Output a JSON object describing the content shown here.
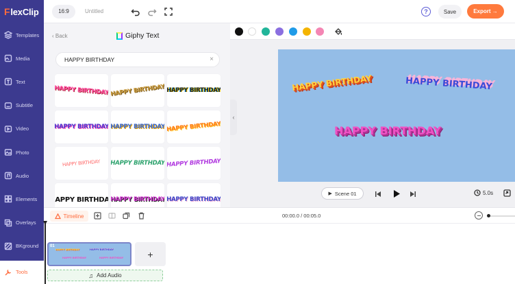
{
  "app": {
    "brand_f": "F",
    "brand_rest": "lexClip"
  },
  "topbar": {
    "ratio": "16:9",
    "title": "Untitled",
    "save": "Save",
    "export": "Export →",
    "help": "?"
  },
  "sidebar": {
    "items": [
      {
        "label": "Templates",
        "icon": "templates-icon"
      },
      {
        "label": "Media",
        "icon": "media-icon"
      },
      {
        "label": "Text",
        "icon": "text-icon"
      },
      {
        "label": "Subtitle",
        "icon": "subtitle-icon"
      },
      {
        "label": "Video",
        "icon": "video-icon"
      },
      {
        "label": "Photo",
        "icon": "photo-icon"
      },
      {
        "label": "Audio",
        "icon": "audio-icon"
      },
      {
        "label": "Elements",
        "icon": "elements-icon"
      },
      {
        "label": "Overlays",
        "icon": "overlays-icon"
      },
      {
        "label": "BKground",
        "icon": "background-icon"
      },
      {
        "label": "Tools",
        "icon": "tools-icon",
        "active": true
      }
    ]
  },
  "panel": {
    "back": "‹ Back",
    "title": "Giphy Text",
    "search_value": "HAPPY BIRTHDAY",
    "search_clear": "×",
    "thumbs": [
      {
        "text": "HAPPY BIRTHDAY",
        "color": "#ff4fa3"
      },
      {
        "text": "HAPPY BIRTHDAY",
        "color": "#c89a3c"
      },
      {
        "text": "HAPPY BIRTHDAY",
        "color": "#222222"
      },
      {
        "text": "HAPPY BIRTHDAY",
        "color": "#4b3bd1"
      },
      {
        "text": "HAPPY BIRTHDAY",
        "color": "#3a6bd8"
      },
      {
        "text": "HAPPY BIRTHDAY",
        "color": "#ff7a1a"
      },
      {
        "text": "HAPPY BIRTHDAY",
        "color": "#ff6e6e"
      },
      {
        "text": "HAPPY BIRTHDAY",
        "color": "#2ea36e"
      },
      {
        "text": "HAPPY BIRTHDAY",
        "color": "#b23ce0"
      },
      {
        "text": "HAPPY BIRTHDAY",
        "color": "#111111"
      },
      {
        "text": "HAPPY BIRTHDAY",
        "color": "#d63ad6"
      },
      {
        "text": "HAPPY BIRTHDAY",
        "color": "#3846c8"
      }
    ]
  },
  "editor": {
    "swatches": [
      "#111111",
      "#ffffff",
      "#22b59a",
      "#8b6fe0",
      "#1f9be8",
      "#f4b400",
      "#f486b4"
    ],
    "canvas_texts": [
      {
        "text": "HAPPY BIRTHDAY",
        "color": "#ffd23f",
        "shadow": "#e0531f"
      },
      {
        "text": "HAPPY BIRTHDAY",
        "color": "#3a4bd8",
        "shadow": "#f7b4d9"
      },
      {
        "text": "HAPPY BIRTHDAY",
        "color": "#ef52c4",
        "shadow": "#b03496"
      }
    ],
    "scene_label": "Scene 01",
    "duration": "5.0s"
  },
  "timeline": {
    "tab": "Timeline",
    "timecode": "00:00.0 / 00:05.0",
    "clip_number": "01",
    "add_scene": "+",
    "add_audio": "Add Audio"
  }
}
